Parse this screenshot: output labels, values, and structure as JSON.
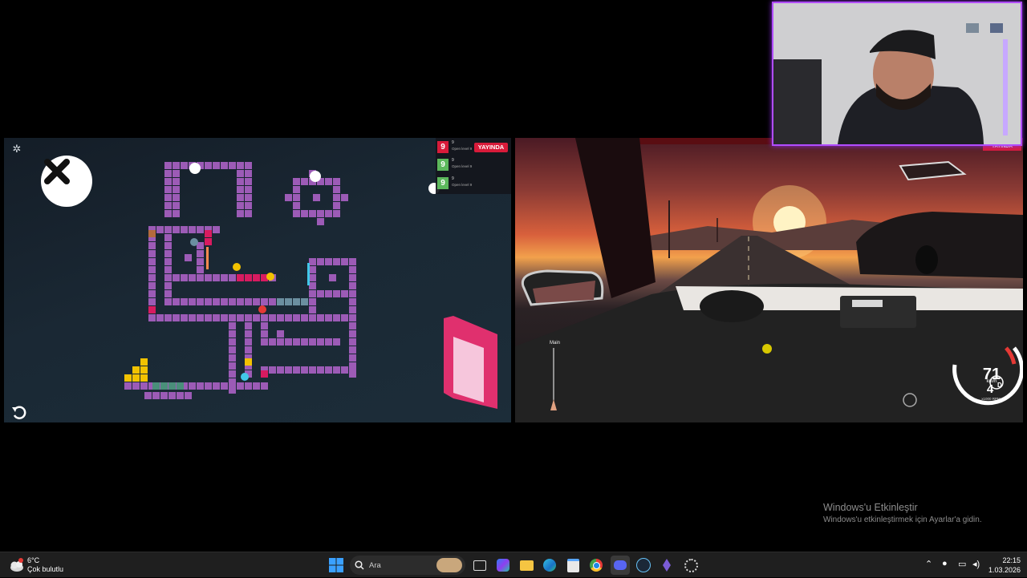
{
  "puzzle_game": {
    "settings_icon": "gear-icon",
    "close_icon": "close-icon",
    "undo_icon": "undo-icon",
    "colors": {
      "wall": "#9c5bb6",
      "accent": "#d81b60",
      "gold": "#f2c200",
      "cyan": "#41c7e8",
      "teal": "#4a8f7a"
    }
  },
  "chat_overlay": {
    "live_label": "YAYINDA",
    "rows": [
      {
        "badge": "9",
        "badge_color": "#d81b3a",
        "name": "9",
        "msg": "Open level 9"
      },
      {
        "badge": "9",
        "badge_color": "#5cb85c",
        "name": "9",
        "msg": "Open level 9"
      },
      {
        "badge": "9",
        "badge_color": "#5cb85c",
        "name": "9",
        "msg": "Open level 9"
      }
    ]
  },
  "driving_game": {
    "live_label": "YAYINDA",
    "route_label": "Main",
    "speed": "71",
    "speed_unit": "km/h",
    "gear": "4",
    "rpm_unit": "x1000 RPM",
    "drive_mode": "D"
  },
  "watermark": {
    "title": "Windows'u Etkinleştir",
    "subtitle": "Windows'u etkinleştirmek için Ayarlar'a gidin."
  },
  "taskbar": {
    "weather": {
      "temp": "6°C",
      "condition": "Çok bulutlu",
      "icon": "cloud-icon"
    },
    "search_placeholder": "Ara",
    "apps": [
      "windows-start-icon",
      "search-icon",
      "task-view-icon",
      "m365-icon",
      "file-explorer-icon",
      "edge-icon",
      "store-icon",
      "chrome-icon",
      "discord-icon",
      "steam-icon",
      "obs-icon",
      "settings-icon"
    ],
    "tray": [
      "chevron-up-icon",
      "microphone-icon",
      "network-icon",
      "volume-icon"
    ],
    "time": "22:15",
    "date": "1.03.2026"
  }
}
